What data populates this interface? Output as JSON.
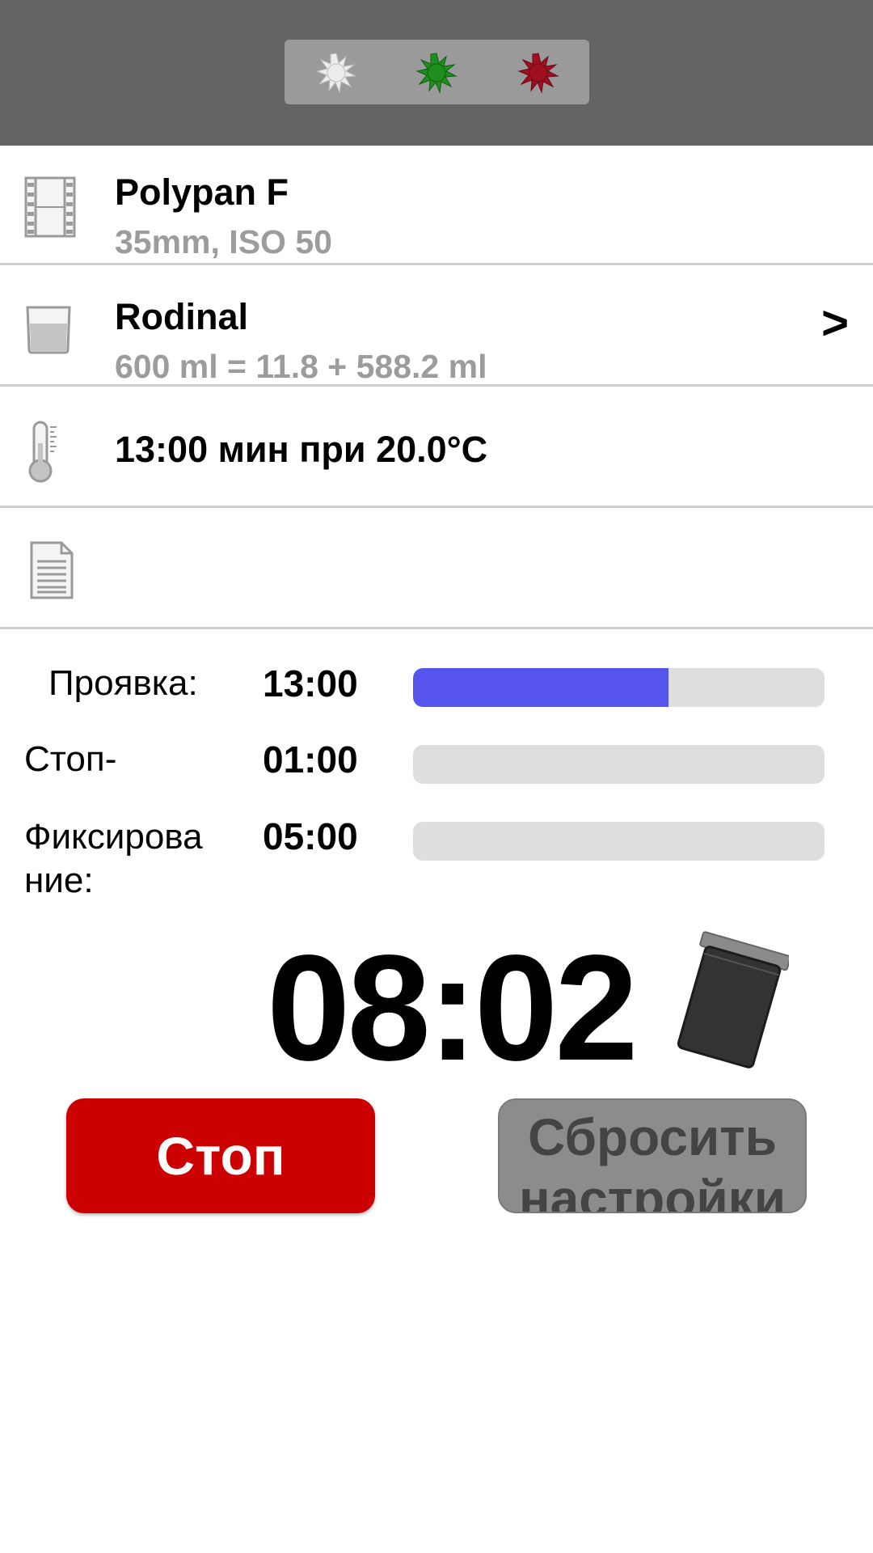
{
  "header": {
    "safelight_options": [
      {
        "icon": "white-light-icon",
        "color": "#e8e8e8"
      },
      {
        "icon": "green-light-icon",
        "color": "#1e8e1e"
      },
      {
        "icon": "red-light-icon",
        "color": "#9e1020"
      }
    ]
  },
  "film": {
    "name": "Polypan F",
    "details": "35mm, ISO 50",
    "icon": "film-strip-icon"
  },
  "developer": {
    "name": "Rodinal",
    "details": "600 ml = 11.8 + 588.2 ml",
    "icon": "beaker-icon",
    "chevron": ">"
  },
  "temperature": {
    "text": "13:00 мин при 20.0°C",
    "icon": "thermometer-icon"
  },
  "notes": {
    "icon": "document-icon"
  },
  "stages": [
    {
      "label": "Проявка:",
      "time": "13:00",
      "progress": 0.62
    },
    {
      "label": "Стоп-",
      "time": "01:00",
      "progress": 0
    },
    {
      "label": "Фиксирование:",
      "time": "05:00",
      "progress": 0
    }
  ],
  "timer": {
    "value": "08:02",
    "icon": "developing-tank-icon"
  },
  "buttons": {
    "stop_label": "Стоп",
    "reset_label": "Сбросить настройки"
  },
  "colors": {
    "progress_fill": "#5555ee",
    "stop_button": "#cc0000",
    "reset_button": "#8c8c8c"
  }
}
